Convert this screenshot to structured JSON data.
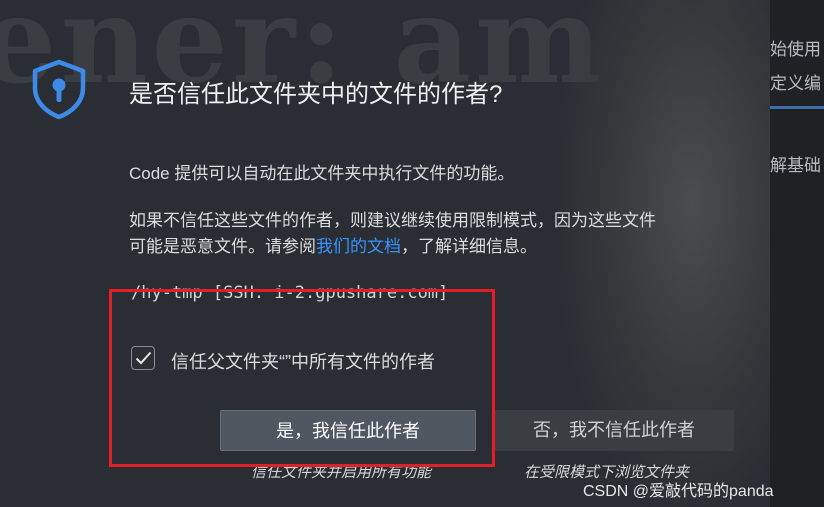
{
  "background": {
    "wallpaper_text": "ener: am",
    "right_panel_lines": [
      "始使用",
      "定义编",
      "解基础"
    ],
    "watermark": "CSDN @爱敲代码的panda"
  },
  "dialog": {
    "icon": "shield-lock-icon",
    "title": "是否信任此文件夹中的文件的作者?",
    "line1": "Code 提供可以自动在此文件夹中执行文件的功能。",
    "line2": "如果不信任这些文件的作者，则建议继续使用限制模式，因为这些文件",
    "line3_prefix": "可能是恶意文件。请参阅",
    "line3_link": "我们的文档",
    "line3_suffix": "，了解详细信息。",
    "folder_path": "/hy-tmp [SSH: i-2.gpushare.com]",
    "checkbox_label": "信任父文件夹“”中所有文件的作者",
    "checkbox_checked": true,
    "trust_button": "是，我信任此作者",
    "trust_desc": "信任文件夹并启用所有功能",
    "distrust_button": "否，我不信任此作者",
    "distrust_desc": "在受限模式下浏览文件夹"
  },
  "colors": {
    "link": "#3794ff",
    "highlight": "#e11f26",
    "accent_icon": "#3d8be8"
  }
}
